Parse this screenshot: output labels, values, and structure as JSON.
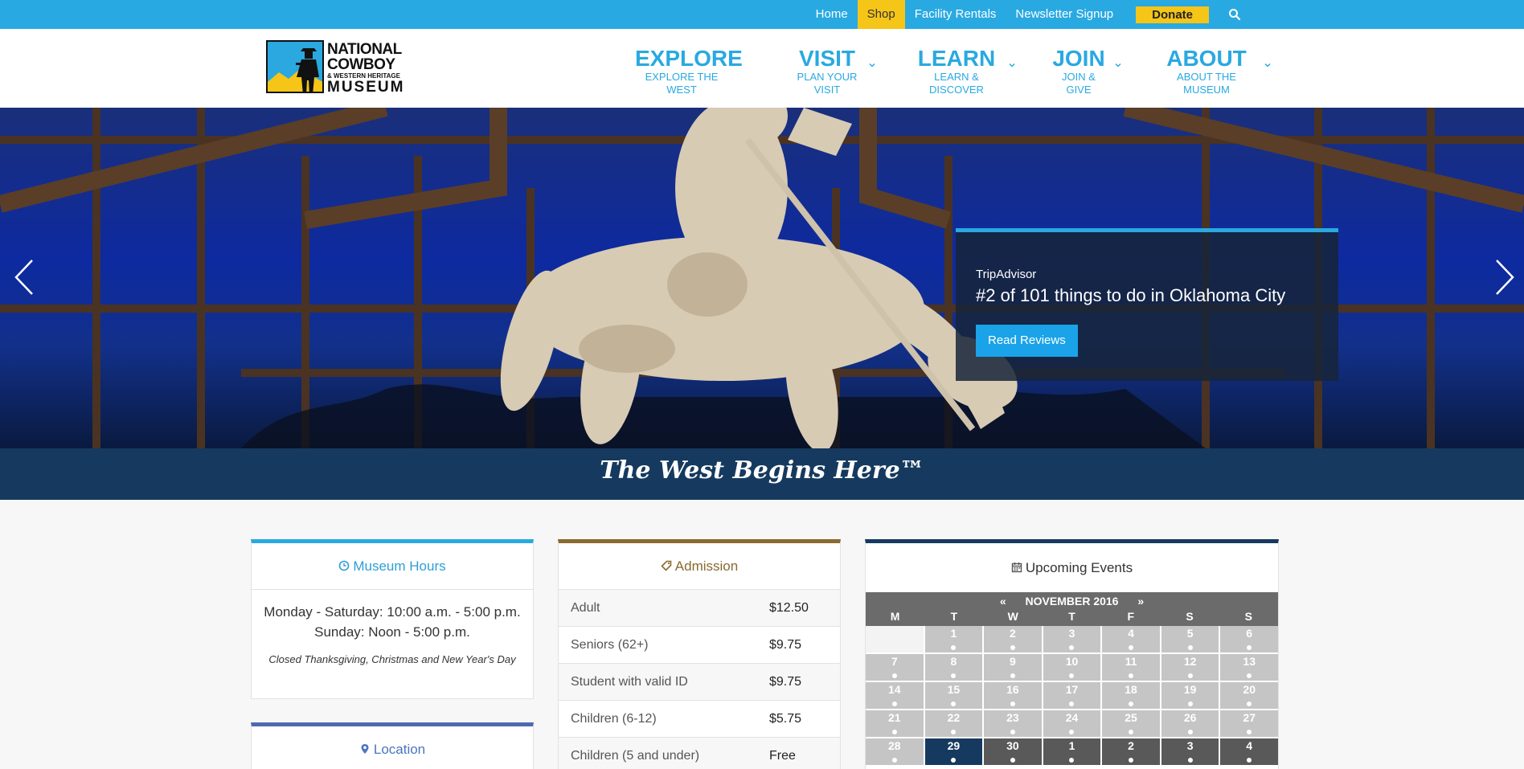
{
  "topbar": {
    "links": [
      "Home",
      "Shop",
      "Facility Rentals",
      "Newsletter Signup"
    ],
    "donate": "Donate"
  },
  "logo": {
    "line1": "NATIONAL",
    "line2": "COWBOY",
    "line3": "& WESTERN HERITAGE",
    "line4": "MUSEUM"
  },
  "nav": [
    {
      "title": "EXPLORE",
      "subtitle": "EXPLORE THE WEST",
      "has_dropdown": false
    },
    {
      "title": "VISIT",
      "subtitle": "PLAN YOUR VISIT",
      "has_dropdown": true
    },
    {
      "title": "LEARN",
      "subtitle": "LEARN & DISCOVER",
      "has_dropdown": true
    },
    {
      "title": "JOIN",
      "subtitle": "JOIN & GIVE",
      "has_dropdown": true
    },
    {
      "title": "ABOUT",
      "subtitle": "ABOUT THE MUSEUM",
      "has_dropdown": true
    }
  ],
  "hero": {
    "source": "TripAdvisor",
    "headline": "#2 of 101 things to do in Oklahoma City",
    "button": "Read Reviews"
  },
  "tagline": "The West Begins Here™",
  "hours": {
    "title": "Museum Hours",
    "line1": "Monday - Saturday: 10:00 a.m. - 5:00 p.m.",
    "line2": "Sunday: Noon - 5:00 p.m.",
    "note": "Closed Thanksgiving, Christmas and New Year's Day"
  },
  "location": {
    "title": "Location"
  },
  "admission": {
    "title": "Admission",
    "rows": [
      {
        "label": "Adult",
        "price": "$12.50"
      },
      {
        "label": "Seniors (62+)",
        "price": "$9.75"
      },
      {
        "label": "Student with valid ID",
        "price": "$9.75"
      },
      {
        "label": "Children (6-12)",
        "price": "$5.75"
      },
      {
        "label": "Children (5 and under)",
        "price": "Free"
      }
    ]
  },
  "events": {
    "title": "Upcoming Events",
    "prev": "«",
    "next": "»",
    "month": "NOVEMBER 2016",
    "weekdays": [
      "M",
      "T",
      "W",
      "T",
      "F",
      "S",
      "S"
    ],
    "weeks": [
      [
        "",
        "1",
        "2",
        "3",
        "4",
        "5",
        "6"
      ],
      [
        "7",
        "8",
        "9",
        "10",
        "11",
        "12",
        "13"
      ],
      [
        "14",
        "15",
        "16",
        "17",
        "18",
        "19",
        "20"
      ],
      [
        "21",
        "22",
        "23",
        "24",
        "25",
        "26",
        "27"
      ],
      [
        "28",
        "29",
        "30",
        "1",
        "2",
        "3",
        "4"
      ]
    ],
    "today": "29"
  },
  "colors": {
    "accent_blue": "#29a9e1",
    "shop_yellow": "#f5c518",
    "navy": "#163a5f",
    "bronze": "#8a6a2f"
  },
  "icons": {
    "search": "search-icon",
    "clock": "clock-icon",
    "tag": "tag-icon",
    "calendar": "calendar-icon",
    "map_marker": "map-marker-icon"
  }
}
